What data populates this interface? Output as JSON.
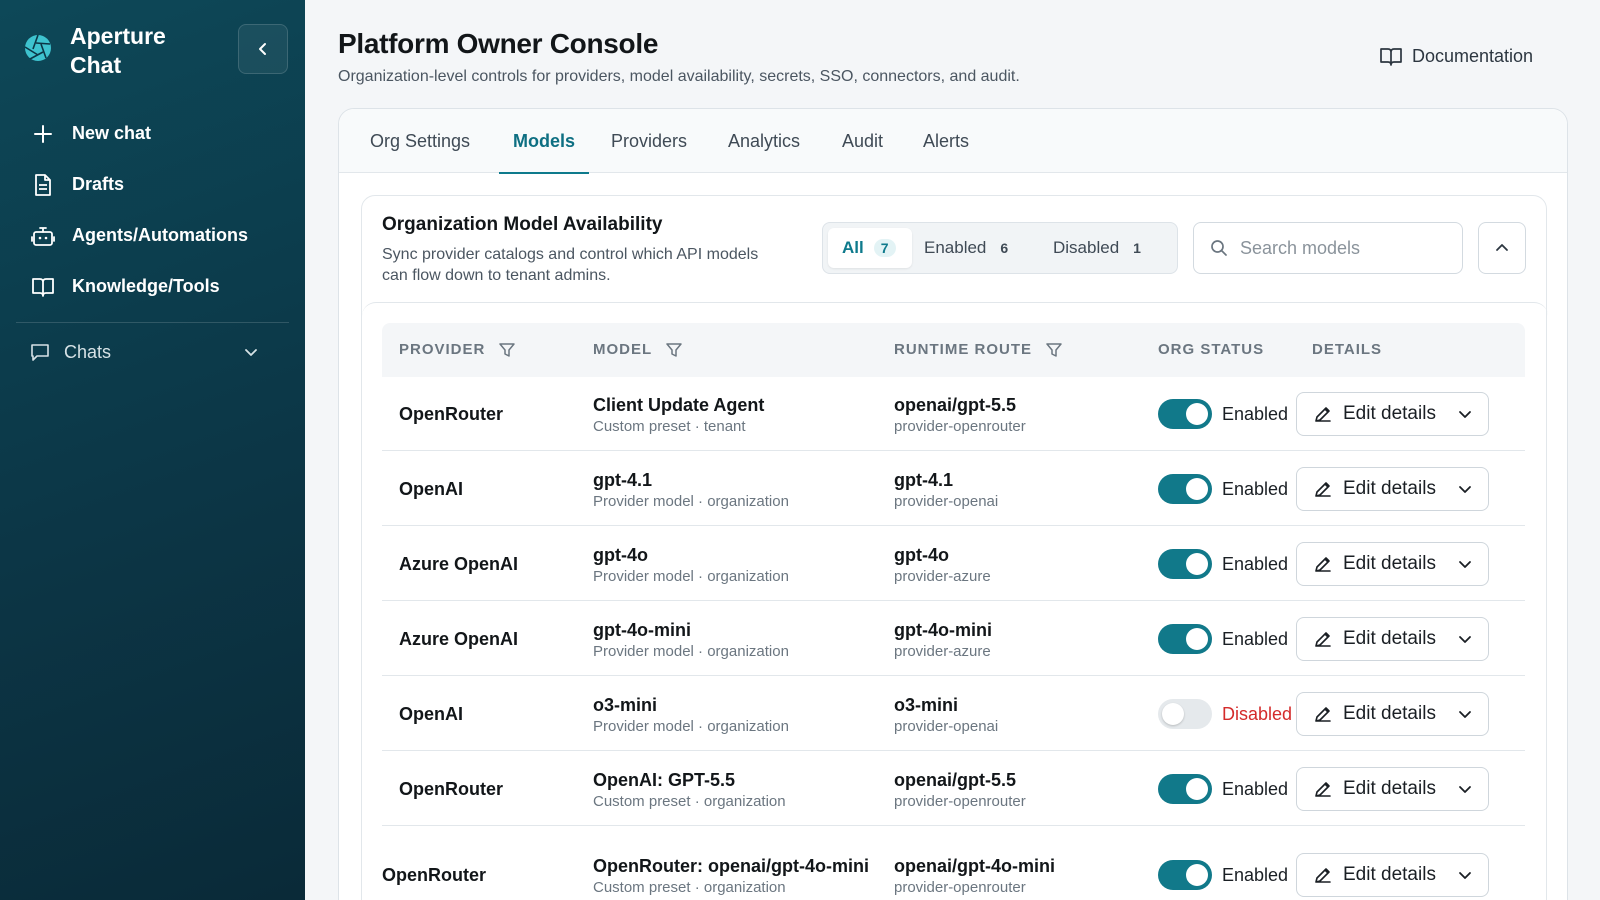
{
  "sidebar": {
    "brand": "Aperture Chat",
    "nav": [
      {
        "label": "New chat",
        "icon": "plus-icon"
      },
      {
        "label": "Drafts",
        "icon": "document-icon"
      },
      {
        "label": "Agents/Automations",
        "icon": "robot-icon"
      },
      {
        "label": "Knowledge/Tools",
        "icon": "book-icon"
      }
    ],
    "chats_label": "Chats"
  },
  "header": {
    "title": "Platform Owner Console",
    "subtitle": "Organization-level controls for providers, model availability, secrets, SSO, connectors, and audit.",
    "documentation": "Documentation"
  },
  "tabs": [
    {
      "label": "Org Settings"
    },
    {
      "label": "Models"
    },
    {
      "label": "Providers"
    },
    {
      "label": "Analytics"
    },
    {
      "label": "Audit"
    },
    {
      "label": "Alerts"
    }
  ],
  "active_tab": "Models",
  "card": {
    "title": "Organization Model Availability",
    "subtitle": "Sync provider catalogs and control which API models can flow down to tenant admins.",
    "filters": [
      {
        "label": "All",
        "count": "7"
      },
      {
        "label": "Enabled",
        "count": "6"
      },
      {
        "label": "Disabled",
        "count": "1"
      }
    ],
    "search_placeholder": "Search models"
  },
  "table": {
    "columns": [
      "PROVIDER",
      "MODEL",
      "RUNTIME ROUTE",
      "ORG STATUS",
      "DETAILS"
    ],
    "edit_label": "Edit details",
    "rows": [
      {
        "provider": "OpenRouter",
        "model": "Client Update Agent",
        "model_sub": "Custom preset · tenant",
        "route": "openai/gpt-5.5",
        "route_sub": "provider-openrouter",
        "status": "Enabled",
        "enabled": true
      },
      {
        "provider": "OpenAI",
        "model": "gpt-4.1",
        "model_sub": "Provider model · organization",
        "route": "gpt-4.1",
        "route_sub": "provider-openai",
        "status": "Enabled",
        "enabled": true
      },
      {
        "provider": "Azure OpenAI",
        "model": "gpt-4o",
        "model_sub": "Provider model · organization",
        "route": "gpt-4o",
        "route_sub": "provider-azure",
        "status": "Enabled",
        "enabled": true
      },
      {
        "provider": "Azure OpenAI",
        "model": "gpt-4o-mini",
        "model_sub": "Provider model · organization",
        "route": "gpt-4o-mini",
        "route_sub": "provider-azure",
        "status": "Enabled",
        "enabled": true
      },
      {
        "provider": "OpenAI",
        "model": "o3-mini",
        "model_sub": "Provider model · organization",
        "route": "o3-mini",
        "route_sub": "provider-openai",
        "status": "Disabled",
        "enabled": false
      },
      {
        "provider": "OpenRouter",
        "model": "OpenAI: GPT-5.5",
        "model_sub": "Custom preset · organization",
        "route": "openai/gpt-5.5",
        "route_sub": "provider-openrouter",
        "status": "Enabled",
        "enabled": true
      },
      {
        "provider": "OpenRouter",
        "model": "OpenRouter: openai/gpt-4o-mini",
        "model_sub": "Custom preset · organization",
        "route": "openai/gpt-4o-mini",
        "route_sub": "provider-openrouter",
        "status": "Enabled",
        "enabled": true
      }
    ]
  },
  "colors": {
    "accent": "#0e7a8c",
    "sidebar": "#0c3646",
    "disabled": "#d42b2b"
  }
}
